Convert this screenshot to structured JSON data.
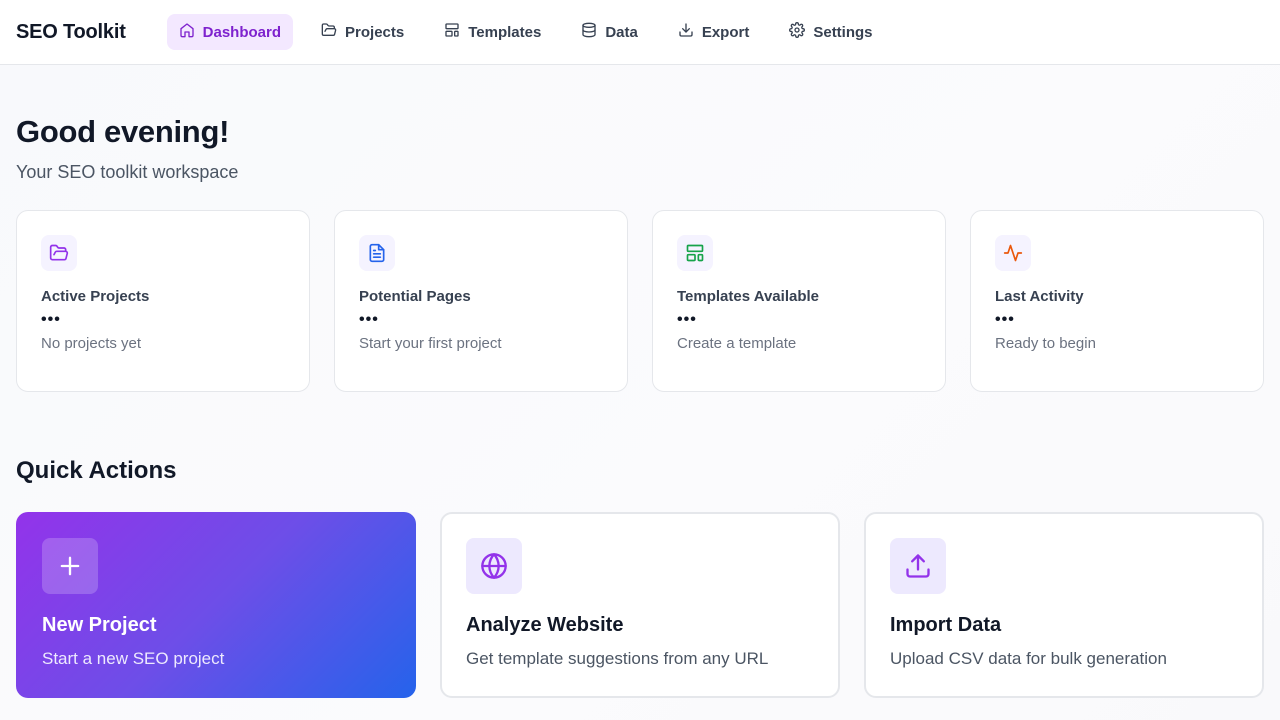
{
  "app": {
    "title": "SEO Toolkit"
  },
  "nav": [
    {
      "label": "Dashboard",
      "icon": "home-icon"
    },
    {
      "label": "Projects",
      "icon": "folder-open-icon"
    },
    {
      "label": "Templates",
      "icon": "layout-template-icon"
    },
    {
      "label": "Data",
      "icon": "database-icon"
    },
    {
      "label": "Export",
      "icon": "download-icon"
    },
    {
      "label": "Settings",
      "icon": "gear-icon"
    }
  ],
  "header": {
    "greeting": "Good evening!",
    "subtitle": "Your SEO toolkit workspace"
  },
  "stats": [
    {
      "label": "Active Projects",
      "value": "•••",
      "note": "No projects yet",
      "icon": "folder-open-icon",
      "color": "#9333ea"
    },
    {
      "label": "Potential Pages",
      "value": "•••",
      "note": "Start your first project",
      "icon": "file-text-icon",
      "color": "#2563eb"
    },
    {
      "label": "Templates Available",
      "value": "•••",
      "note": "Create a template",
      "icon": "layout-template-icon",
      "color": "#16a34a"
    },
    {
      "label": "Last Activity",
      "value": "•••",
      "note": "Ready to begin",
      "icon": "activity-icon",
      "color": "#ea580c"
    }
  ],
  "quick_actions": {
    "title": "Quick Actions",
    "items": [
      {
        "title": "New Project",
        "description": "Start a new SEO project",
        "icon": "plus-icon"
      },
      {
        "title": "Analyze Website",
        "description": "Get template suggestions from any URL",
        "icon": "globe-icon"
      },
      {
        "title": "Import Data",
        "description": "Upload CSV data for bulk generation",
        "icon": "upload-icon"
      }
    ]
  },
  "colors": {
    "accent": "#9333ea",
    "accent_bg": "#f3e8ff",
    "gradient_end": "#2563eb"
  }
}
